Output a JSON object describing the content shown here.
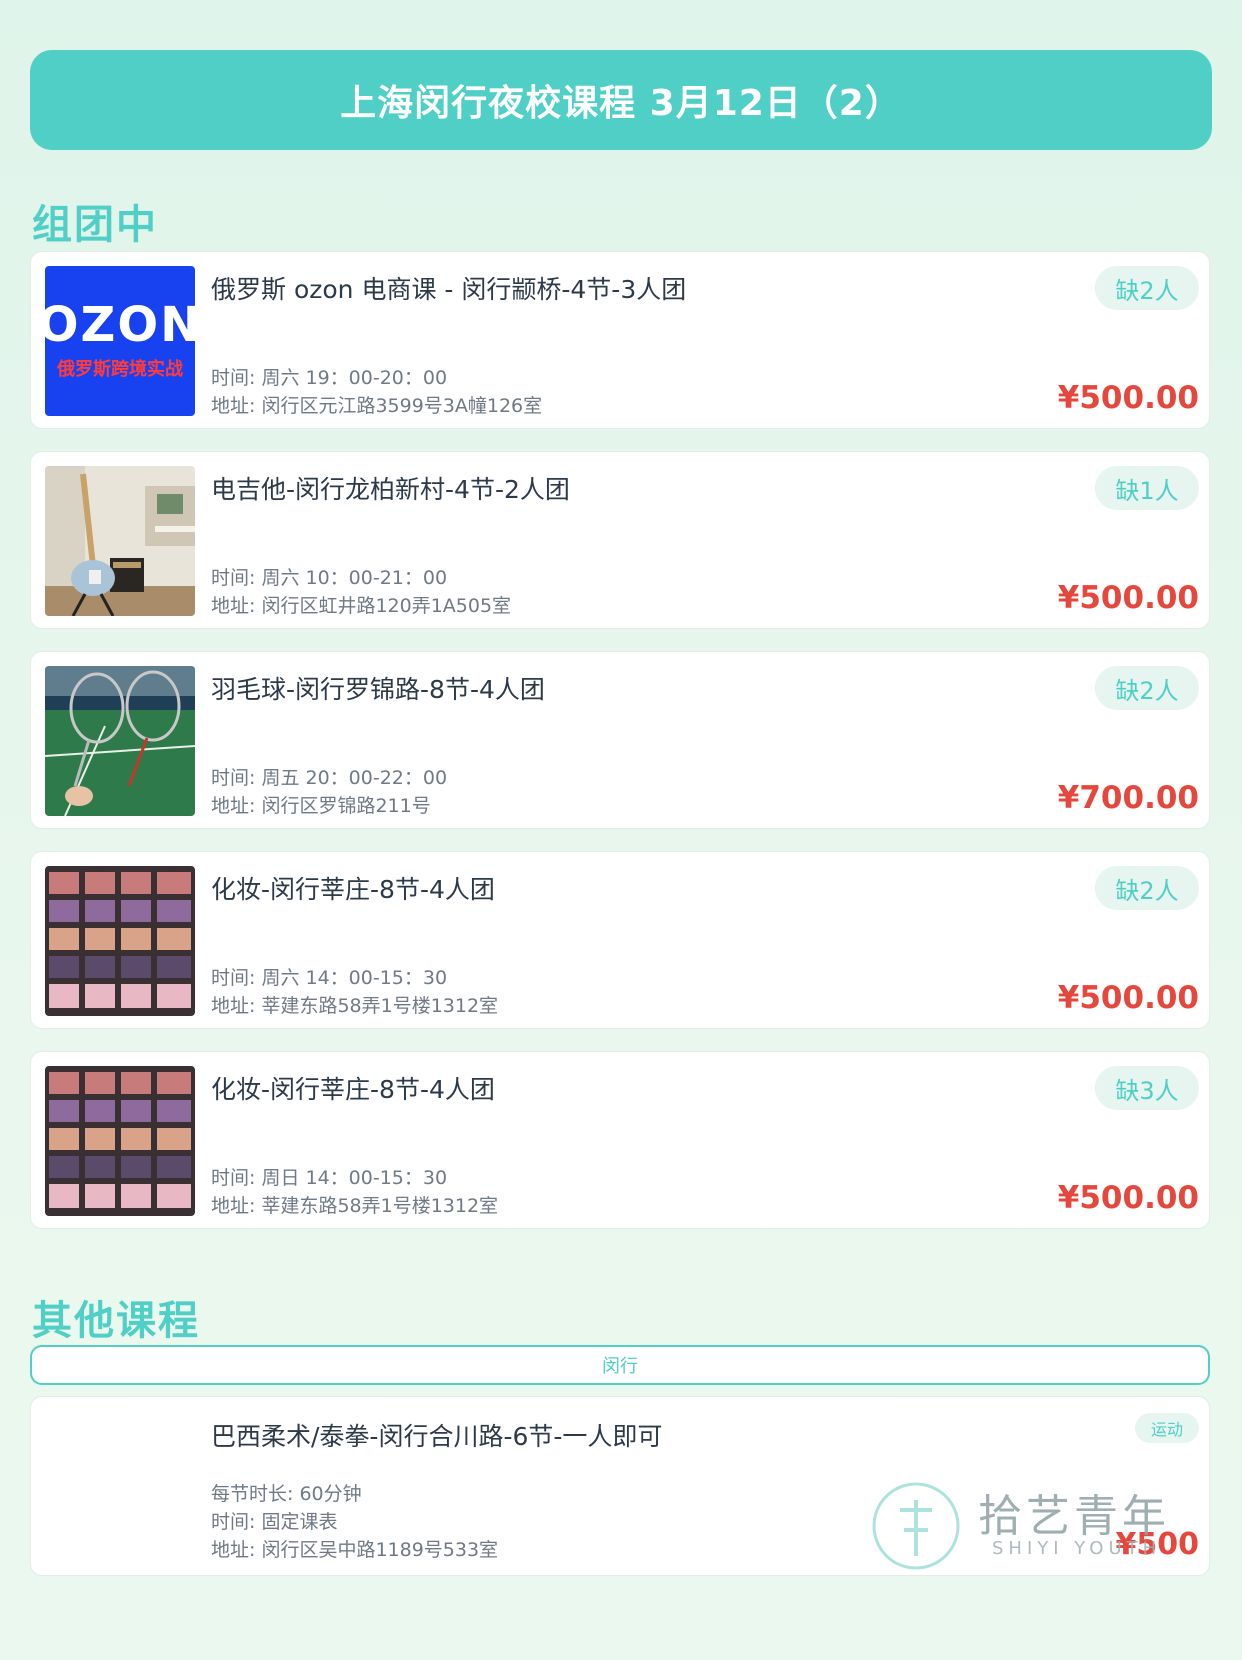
{
  "header": {
    "title": "上海闵行夜校课程 3月12日（2）"
  },
  "sections": {
    "grouping": "组团中",
    "other": "其他课程"
  },
  "colors": {
    "accent": "#4fcfc5",
    "price": "#e5473c",
    "ozon_bg": "#1842f0"
  },
  "group_courses": [
    {
      "title": "俄罗斯 ozon 电商课 - 闵行颛桥-4节-3人团",
      "time": "时间: 周六 19：00-20：00",
      "address": "地址: 闵行区元江路3599号3A幢126室",
      "badge": "缺2人",
      "price": "¥500.00",
      "thumb": {
        "logo": "OZON",
        "caption": "俄罗斯跨境实战"
      }
    },
    {
      "title": "电吉他-闵行龙柏新村-4节-2人团",
      "time": "时间: 周六 10：00-21：00",
      "address": "地址: 闵行区虹井路120弄1A505室",
      "badge": "缺1人",
      "price": "¥500.00",
      "thumb": {
        "icon": "guitar-photo"
      }
    },
    {
      "title": "羽毛球-闵行罗锦路-8节-4人团",
      "time": "时间: 周五 20：00-22：00",
      "address": "地址: 闵行区罗锦路211号",
      "badge": "缺2人",
      "price": "¥700.00",
      "thumb": {
        "icon": "badminton-photo"
      }
    },
    {
      "title": "化妆-闵行莘庄-8节-4人团",
      "time": "时间: 周六 14：00-15：30",
      "address": "地址: 莘建东路58弄1号楼1312室",
      "badge": "缺2人",
      "price": "¥500.00",
      "thumb": {
        "icon": "makeup-photo"
      }
    },
    {
      "title": "化妆-闵行莘庄-8节-4人团",
      "time": "时间: 周日 14：00-15：30",
      "address": "地址: 莘建东路58弄1号楼1312室",
      "badge": "缺3人",
      "price": "¥500.00",
      "thumb": {
        "icon": "makeup-photo"
      }
    }
  ],
  "other": {
    "tab": "闵行",
    "course": {
      "title": "巴西柔术/泰拳-闵行合川路-6节-一人即可",
      "duration": "每节时长: 60分钟",
      "time": "时间: 固定课表",
      "address": "地址: 闵行区吴中路1189号533室",
      "tag": "运动",
      "price": "¥500"
    }
  },
  "watermark": {
    "brand": "拾艺青年",
    "brand_en": "SHIYI YOUTH"
  }
}
